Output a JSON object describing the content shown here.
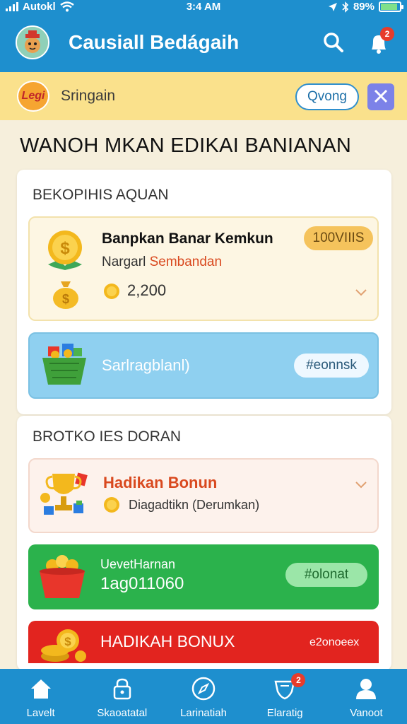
{
  "status_bar": {
    "carrier": "Autokl",
    "time": "3:4 AM",
    "battery": "89%",
    "battery_level": 0.89
  },
  "header": {
    "title": "Causiall Bedágaih",
    "notification_count": "2",
    "icons": [
      "avatar",
      "search-icon",
      "bell-icon"
    ]
  },
  "promo": {
    "logo_text": "Legi",
    "text": "Sringain",
    "button_label": "Qvong",
    "close_icon": "close-icon"
  },
  "page_heading": "WANOH MKAN EDIKAI BANIANAN",
  "section1": {
    "title": "BEKOPIHIS AQUAN",
    "reward_card": {
      "title": "Banpkan Banar Kemkun",
      "badge": "100VIIIS",
      "subtitle_prefix": "Nargarl",
      "subtitle_highlight": "Sembandan",
      "coins": "2,200"
    },
    "blue_card": {
      "label": "Sarlragblanl)",
      "button_label": "#eonnsk"
    }
  },
  "section2": {
    "title": "BROTKO IES DORAN",
    "trophy_card": {
      "title": "Hadikan Bonun",
      "subtitle": "Diagadtikn (Derumkan)"
    },
    "green_card": {
      "label": "UevetHarnan",
      "value": "1ag011060",
      "button_label": "#olonat"
    },
    "red_card": {
      "label": "HADIKAH BONUX",
      "value": "e2onoeex"
    }
  },
  "bottom_nav": [
    {
      "label": "Lavelt",
      "icon": "home-icon"
    },
    {
      "label": "Skaoatatal",
      "icon": "lock-icon"
    },
    {
      "label": "Larinatiah",
      "icon": "compass-icon"
    },
    {
      "label": "Elaratig",
      "icon": "shield-icon",
      "badge": "2"
    },
    {
      "label": "Vanoot",
      "icon": "profile-icon"
    }
  ],
  "colors": {
    "primary_blue": "#1e8fce",
    "promo_yellow": "#fae18c",
    "green_card": "#2bb24c",
    "red_card": "#e2241f",
    "accent_orange": "#d9491f"
  }
}
